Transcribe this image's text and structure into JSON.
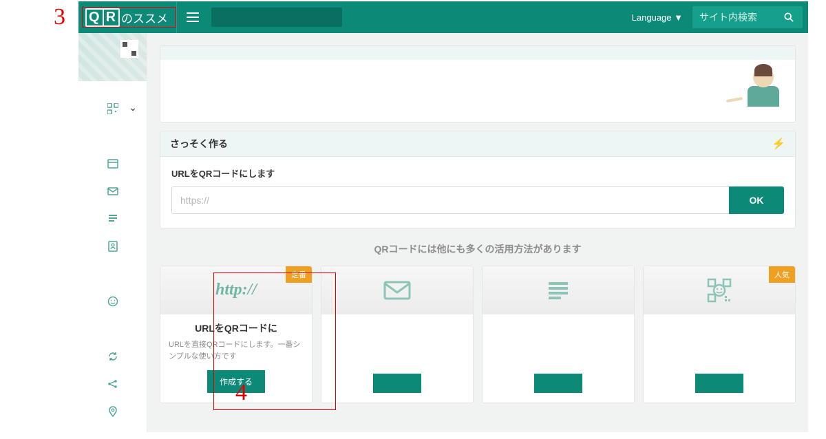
{
  "annotations": {
    "n3": "3",
    "n4": "4"
  },
  "topbar": {
    "logo_q": "Q",
    "logo_r": "R",
    "logo_suffix": "のススメ",
    "language_label": "Language ▼",
    "search_placeholder": "サイト内検索"
  },
  "make_panel": {
    "header": "さっそく作る",
    "label": "URLをQRコードにします",
    "placeholder": "https://",
    "ok": "OK"
  },
  "section_title": "QRコードには他にも多くの活用方法があります",
  "cards": [
    {
      "badge": "定番",
      "http": "http://",
      "title": "URLをQRコードに",
      "desc": "URLを直接QRコードにします。一番シンプルな使い方です",
      "action": "作成する"
    },
    {
      "badge": "",
      "title": "",
      "desc": "",
      "action": ""
    },
    {
      "badge": "",
      "title": "",
      "desc": "",
      "action": ""
    },
    {
      "badge": "人気",
      "title": "",
      "desc": "",
      "action": ""
    }
  ]
}
